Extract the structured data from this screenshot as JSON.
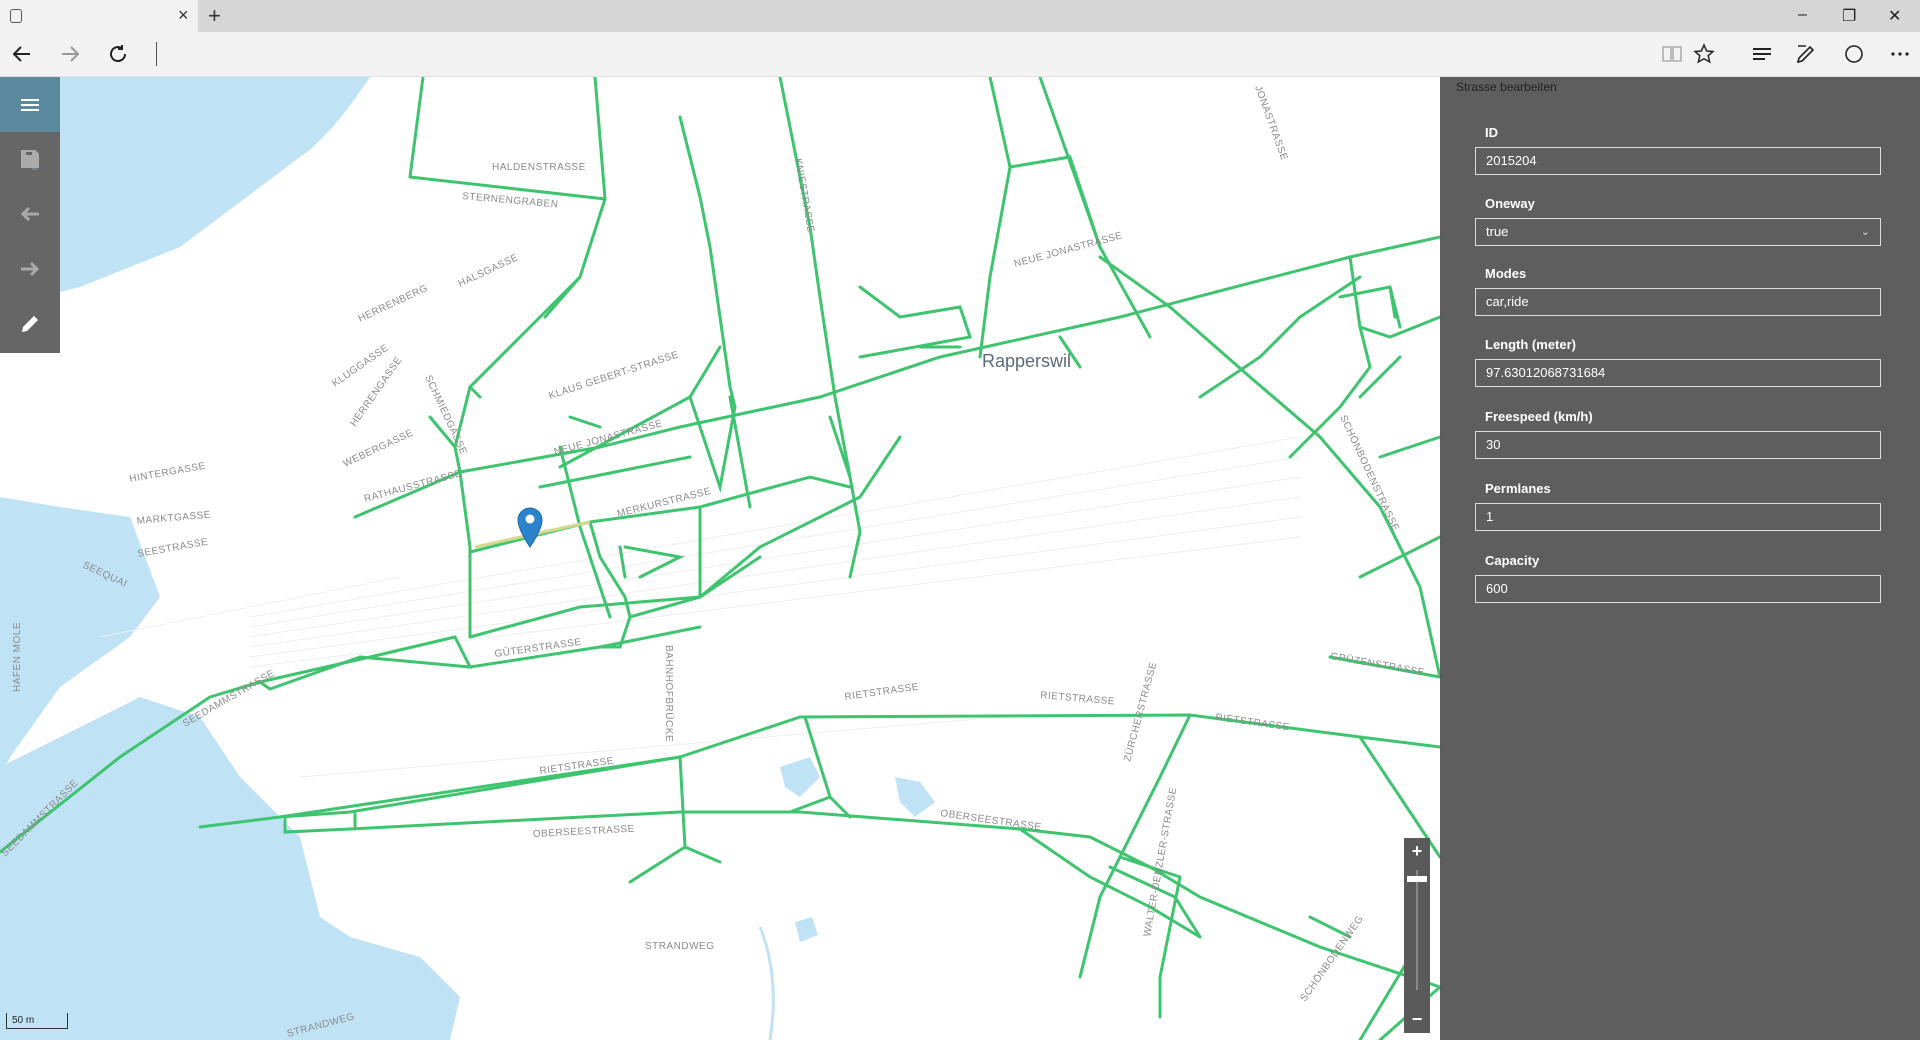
{
  "browser": {
    "tab_close": "×",
    "new_tab": "+",
    "win_min": "–",
    "win_restore": "❐",
    "win_close": "✕"
  },
  "toolbar": {
    "save_count": "0"
  },
  "map": {
    "city_label": "Rapperswil",
    "scale_label": "50 m",
    "street_labels": [
      "HALDENSTRASSE",
      "STERNENGRABEN",
      "HALSGASSE",
      "HERRENBERG",
      "KLUGGASSE",
      "HERRENGASSE",
      "SCHMIEDGASSE",
      "WEBERGASSE",
      "HINTERGASSE",
      "MARKTGASSE",
      "SEESTRASSE",
      "SEEQUAI",
      "RATHAUSSTRASSE",
      "NEUE JONASTRASSE",
      "KLAUS GEBERT-STRASSE",
      "MERKURSTRASSE",
      "GÜTERSTRASSE",
      "BAHNHOFBRÜCKE",
      "RIETSTRASSE",
      "OBERSEESTRASSE",
      "SEEDAMMSTRASSE",
      "STRANDWEG",
      "HAFEN MOLE",
      "SCHÖNBODENSTRASSE",
      "GRÜZENSTRASSE",
      "SCHÖNBODENWEG",
      "WALTER-DENZLER-STRASSE",
      "ZÜRCHERSTRASSE",
      "JONASTRASSE",
      "KNIESTRASSE",
      "NEUE JONASTRASSE"
    ]
  },
  "panel": {
    "title": "Strasse bearbeiten",
    "fields": {
      "id": {
        "label": "ID",
        "value": "2015204"
      },
      "oneway": {
        "label": "Oneway",
        "value": "true"
      },
      "modes": {
        "label": "Modes",
        "value": "car,ride"
      },
      "length": {
        "label": "Length (meter)",
        "value": "97.63012068731684"
      },
      "freespeed": {
        "label": "Freespeed (km/h)",
        "value": "30"
      },
      "permlanes": {
        "label": "Permlanes",
        "value": "1"
      },
      "capacity": {
        "label": "Capacity",
        "value": "600"
      }
    }
  },
  "zoom": {
    "plus": "+",
    "minus": "−"
  },
  "colors": {
    "network": "#3ec46e",
    "water": "#bfe3f5",
    "selected": "#d4d98a",
    "marker": "#2b83cb"
  }
}
